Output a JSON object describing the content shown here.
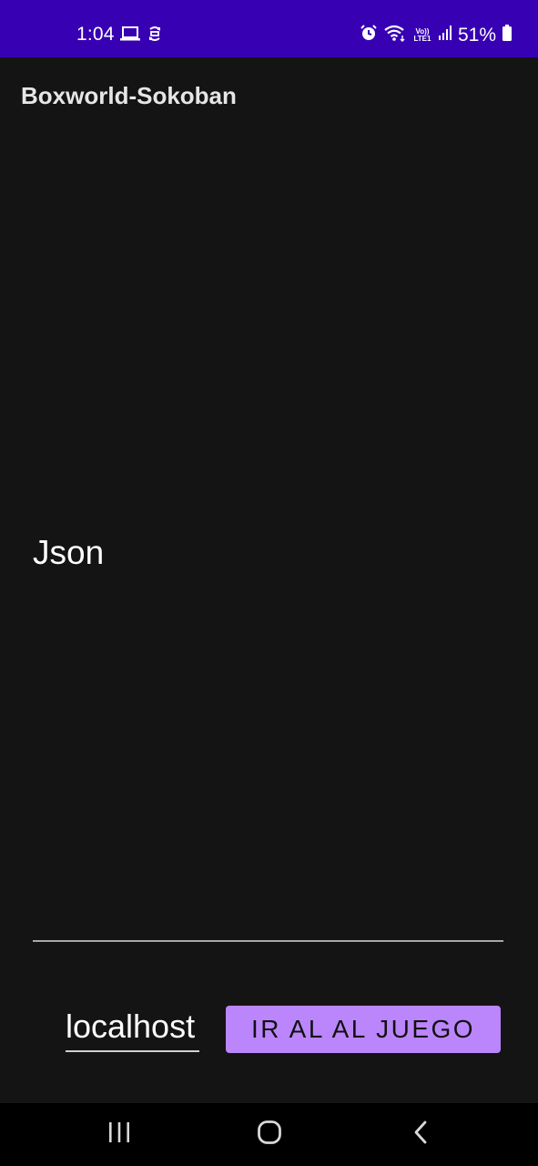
{
  "status_bar": {
    "time": "1:04",
    "battery_percent": "51%",
    "network_label_top": "Vo))",
    "network_label_bottom": "LTE1",
    "left_icons": [
      "laptop-icon",
      "sync-icon"
    ],
    "right_icons": [
      "alarm-icon",
      "wifi-icon",
      "signal-icon",
      "battery-icon"
    ],
    "background_color": "#3700b3"
  },
  "app": {
    "title": "Boxworld-Sokoban",
    "background_color": "#141414"
  },
  "main": {
    "json_label": "Json"
  },
  "form": {
    "host_value": "localhost",
    "go_button_label": "IR AL AL JUEGO",
    "button_color": "#bb86fc"
  },
  "nav_bar": {
    "items": [
      "recent-apps-icon",
      "home-icon",
      "back-icon"
    ]
  }
}
